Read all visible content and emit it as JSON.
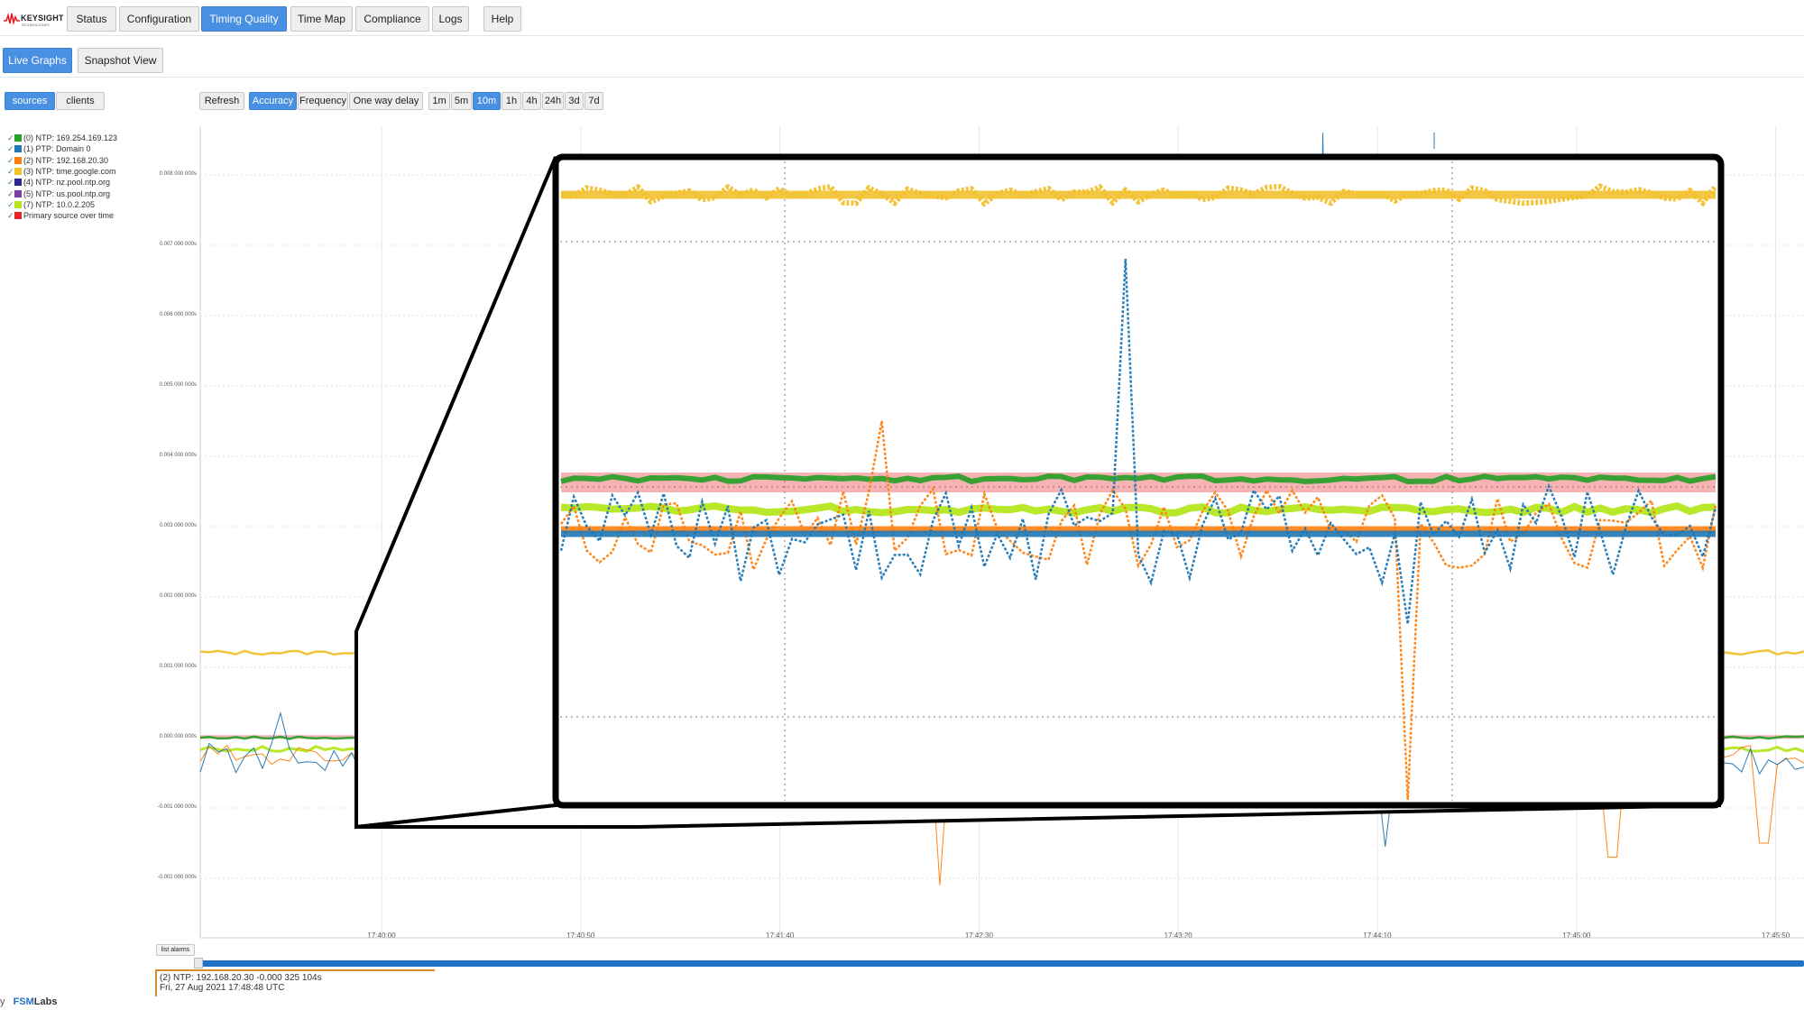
{
  "brand": {
    "name": "KEYSIGHT",
    "sub": "TECHNOLOGIES",
    "color": "#e31b23",
    "icon": "keysight-wave-icon"
  },
  "nav": {
    "items": [
      {
        "label": "Status",
        "active": false
      },
      {
        "label": "Configuration",
        "active": false
      },
      {
        "label": "Timing Quality",
        "active": true
      },
      {
        "label": "Time Map",
        "active": false
      },
      {
        "label": "Compliance",
        "active": false
      },
      {
        "label": "Logs",
        "active": false
      },
      {
        "label": "Help",
        "active": false
      }
    ]
  },
  "subnav": {
    "items": [
      {
        "label": "Live Graphs",
        "active": true
      },
      {
        "label": "Snapshot View",
        "active": false
      }
    ]
  },
  "view_toggle": {
    "items": [
      {
        "label": "sources",
        "active": true
      },
      {
        "label": "clients",
        "active": false
      }
    ]
  },
  "controls": {
    "refresh": "Refresh",
    "modes": [
      {
        "label": "Accuracy",
        "active": true
      },
      {
        "label": "Frequency",
        "active": false
      },
      {
        "label": "One way delay",
        "active": false
      }
    ],
    "ranges": [
      {
        "label": "1m",
        "active": false
      },
      {
        "label": "5m",
        "active": false
      },
      {
        "label": "10m",
        "active": true
      },
      {
        "label": "1h",
        "active": false
      },
      {
        "label": "4h",
        "active": false
      },
      {
        "label": "24h",
        "active": false
      },
      {
        "label": "3d",
        "active": false
      },
      {
        "label": "7d",
        "active": false
      }
    ]
  },
  "legend": [
    {
      "check": "✓",
      "label": "(0) NTP: 169.254.169.123",
      "color": "#2ca02c"
    },
    {
      "check": "✓",
      "label": "(1) PTP: Domain 0",
      "color": "#1f77b4"
    },
    {
      "check": "✓",
      "label": "(2) NTP: 192.168.20.30",
      "color": "#ff7f0e"
    },
    {
      "check": "✓",
      "label": "(3) NTP: time.google.com",
      "color": "#f2c12e"
    },
    {
      "check": "✓",
      "label": "(4) NTP: nz.pool.ntp.org",
      "color": "#2b2b8c"
    },
    {
      "check": "✓",
      "label": "(5) NTP: us.pool.ntp.org",
      "color": "#7b3fa0"
    },
    {
      "check": "✓",
      "label": "(7) NTP: 10.0.2.205",
      "color": "#b5e61d"
    },
    {
      "check": "✓",
      "label": "Primary source over time",
      "color": "#e32626"
    }
  ],
  "chart_data": {
    "type": "line",
    "title": "",
    "y_ticks": [
      "0.008 000 000s",
      "0.007 000 000s",
      "0.006 000 000s",
      "0.005 000 000s",
      "0.004 000 000s",
      "0.003 000 000s",
      "0.002 000 000s",
      "0.001 000 000s",
      "0.000 000 000s",
      "-0.001 000 000s",
      "-0.002 000 000s"
    ],
    "y_values": [
      0.008,
      0.007,
      0.006,
      0.005,
      0.004,
      0.003,
      0.002,
      0.001,
      0.0,
      -0.001,
      -0.002
    ],
    "x_ticks": [
      "17:40:00",
      "17:40:50",
      "17:41:40",
      "17:42:30",
      "17:43:20",
      "17:44:10",
      "17:45:00",
      "17:45:50"
    ],
    "ylim": [
      -0.0028,
      0.0088
    ],
    "grid": true,
    "series": [
      {
        "name": "(3) NTP: time.google.com",
        "level": 0.00121,
        "noise": 3e-05,
        "spikes": []
      },
      {
        "name": "Primary source over time",
        "level": 1e-05,
        "noise": 0.0,
        "spikes": []
      },
      {
        "name": "(0) NTP: 169.254.169.123",
        "level": 0.0,
        "noise": 2e-05,
        "spikes": []
      },
      {
        "name": "(7) NTP: 10.0.2.205",
        "level": -0.00016,
        "noise": 4e-05,
        "spikes": []
      },
      {
        "name": "(2) NTP: 192.168.20.30",
        "level": -0.00025,
        "noise": 0.00015,
        "spikes": [
          {
            "t": 0.145,
            "v": -0.00075
          },
          {
            "t": 0.46,
            "v": -0.0021
          },
          {
            "t": 0.88,
            "v": -0.0017
          },
          {
            "t": 0.975,
            "v": -0.0015
          }
        ]
      },
      {
        "name": "(1) PTP: Domain 0",
        "level": -0.0003,
        "noise": 0.00022,
        "spikes": [
          {
            "t": 0.195,
            "v": 0.00095
          },
          {
            "t": 0.05,
            "v": 0.00035
          },
          {
            "t": 0.74,
            "v": -0.00155
          },
          {
            "t": 0.7,
            "v": 0.0086
          }
        ]
      }
    ]
  },
  "zoom_callout": {
    "series_labels": [
      "(3) NTP: time.google.com",
      "Primary source over time",
      "(0) NTP: 169.254.169.123",
      "(7) NTP: 10.0.2.205",
      "(2) NTP: 192.168.20.30",
      "(1) PTP: Domain 0"
    ]
  },
  "list_alarms": "list alarms",
  "tooltip": {
    "line1": "(2) NTP: 192.168.20.30 -0.000 325 104s",
    "line2": "Fri, 27 Aug 2021 17:48:48 UTC"
  },
  "footer": {
    "prefix": "y",
    "brand_a": "FSM",
    "brand_b": "Labs"
  }
}
